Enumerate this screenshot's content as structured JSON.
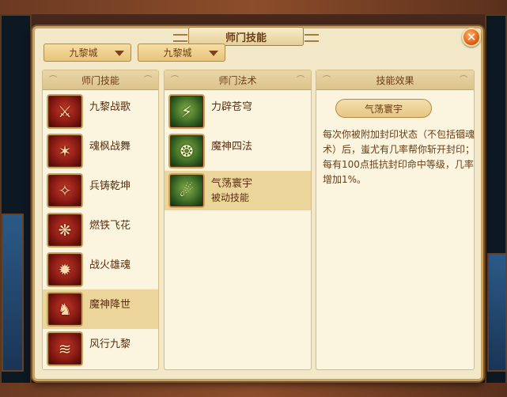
{
  "window": {
    "title": "师门技能",
    "close_icon": "close-icon"
  },
  "dropdowns": [
    {
      "value": "九黎城"
    },
    {
      "value": "九黎城"
    }
  ],
  "columns": {
    "skills_header": "师门技能",
    "spells_header": "师门法术",
    "effect_header": "技能效果"
  },
  "skills": [
    {
      "name": "九黎战歌",
      "icon": "war-song-icon",
      "selected": false
    },
    {
      "name": "魂枫战舞",
      "icon": "maple-dance-icon",
      "selected": false
    },
    {
      "name": "兵铸乾坤",
      "icon": "forge-icon",
      "selected": false
    },
    {
      "name": "燃铁飞花",
      "icon": "flaming-iron-icon",
      "selected": false
    },
    {
      "name": "战火雄魂",
      "icon": "war-fire-icon",
      "selected": false
    },
    {
      "name": "魔神降世",
      "icon": "demon-descent-icon",
      "selected": true
    },
    {
      "name": "风行九黎",
      "icon": "wind-walk-icon",
      "selected": false
    }
  ],
  "spells": [
    {
      "name": "力辟苍穹",
      "sub": "",
      "icon": "sky-split-icon",
      "selected": false
    },
    {
      "name": "魔神四法",
      "sub": "",
      "icon": "demon-four-icon",
      "selected": false
    },
    {
      "name": "气荡寰宇",
      "sub": "被动技能",
      "icon": "qi-wave-icon",
      "selected": true
    }
  ],
  "effect": {
    "title": "气荡寰宇",
    "description": "每次你被附加封印状态（不包括锢魂术）后，蚩尤有几率帮你斩开封印；每有100点抵抗封印命中等级，几率增加1%。"
  },
  "colors": {
    "panel_bg": "#f2e7c6",
    "selected_row": "#ecd59a",
    "text_brown": "#5a2e10",
    "close_button": "#e0641a"
  }
}
